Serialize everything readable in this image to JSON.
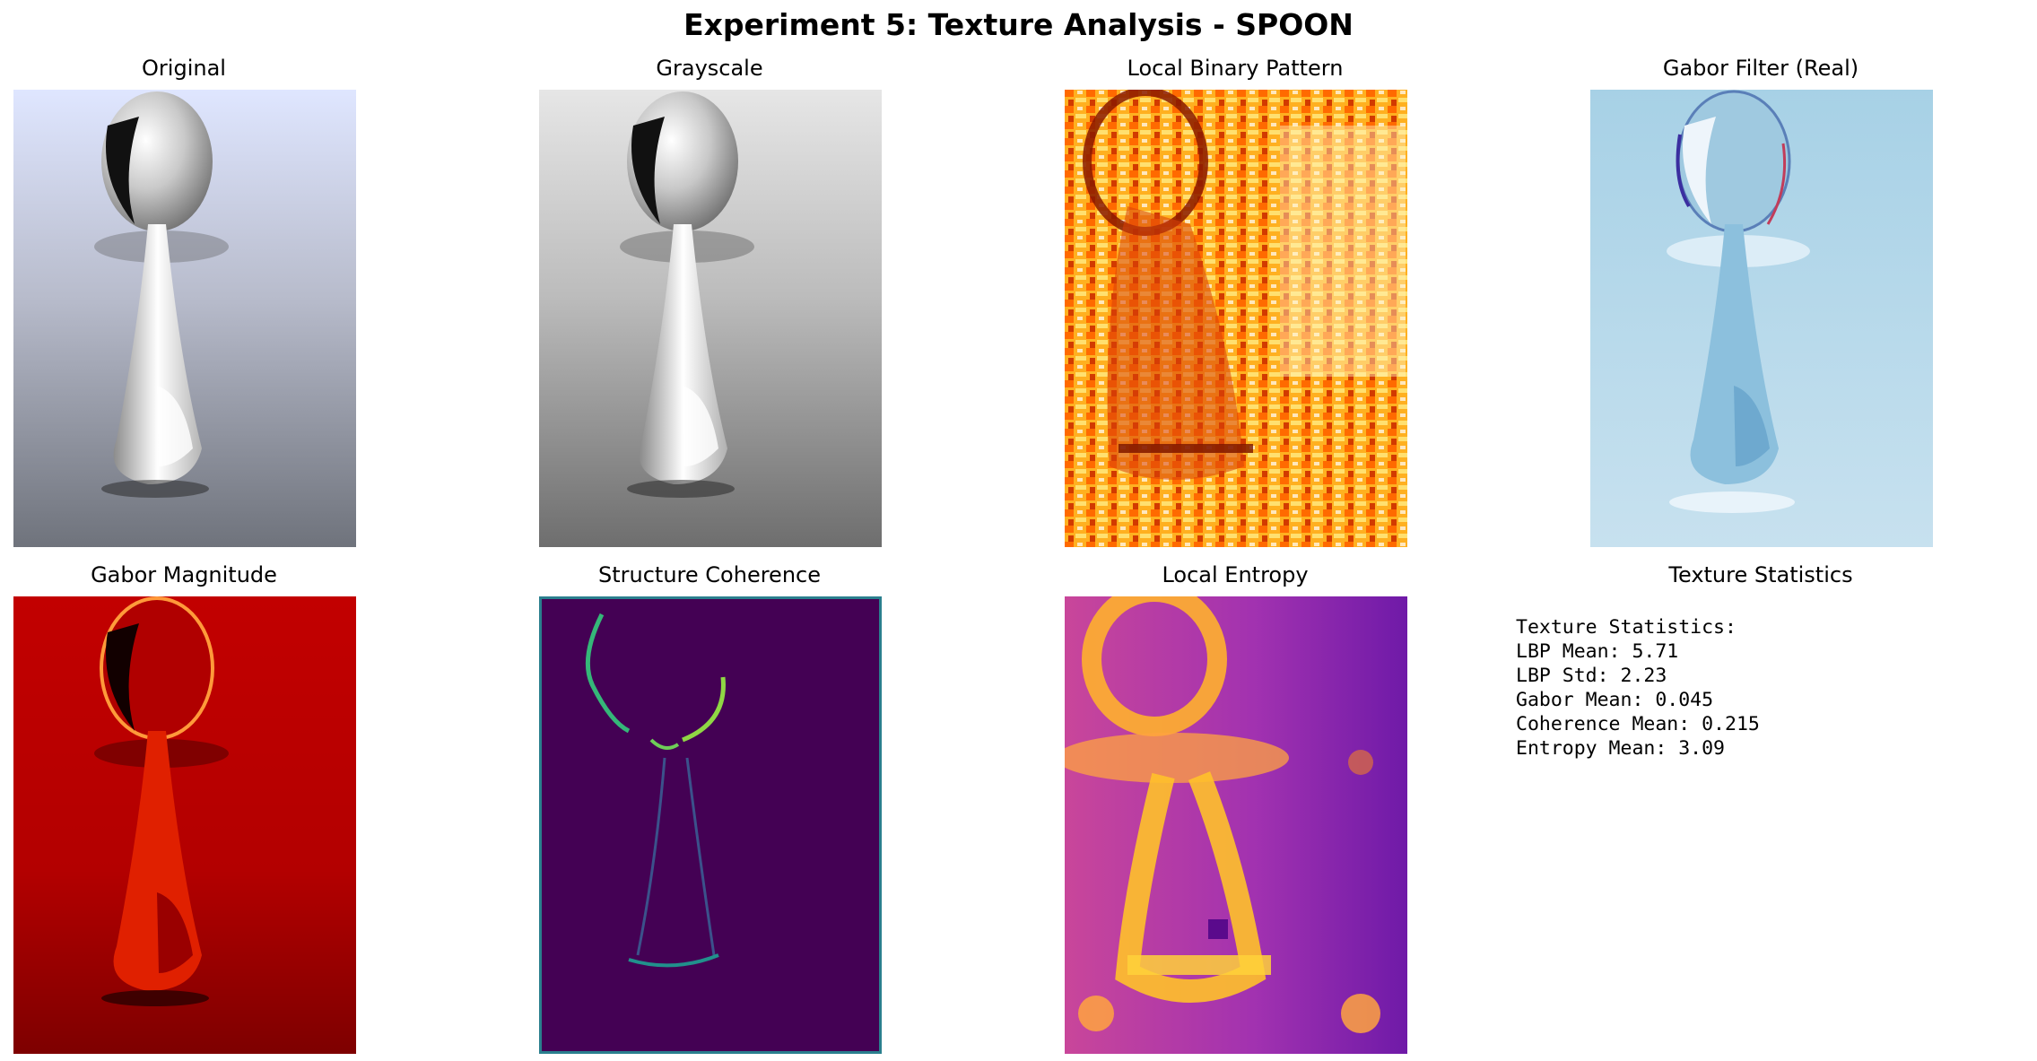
{
  "figure": {
    "title": "Experiment 5: Texture Analysis - SPOON"
  },
  "panels": [
    {
      "title": "Original",
      "icon": "spoon-photo"
    },
    {
      "title": "Grayscale",
      "icon": "spoon-grayscale"
    },
    {
      "title": "Local Binary Pattern",
      "icon": "lbp-heatmap"
    },
    {
      "title": "Gabor Filter (Real)",
      "icon": "gabor-real-map"
    },
    {
      "title": "Gabor Magnitude",
      "icon": "gabor-magnitude-map"
    },
    {
      "title": "Structure Coherence",
      "icon": "coherence-map"
    },
    {
      "title": "Local Entropy",
      "icon": "entropy-map"
    },
    {
      "title": "Texture Statistics"
    }
  ],
  "stats": {
    "heading": "Texture Statistics:",
    "lines": [
      "LBP Mean: 5.71",
      "LBP Std: 2.23",
      "Gabor Mean: 0.045",
      "Coherence Mean: 0.215",
      "Entropy Mean: 3.09"
    ]
  },
  "colors": {
    "lbp": "#f56a00",
    "gabor_real": "#a9d3e8",
    "gabor_mag": "#c00000",
    "coherence": "#440154",
    "entropy": "#8b23b0"
  }
}
